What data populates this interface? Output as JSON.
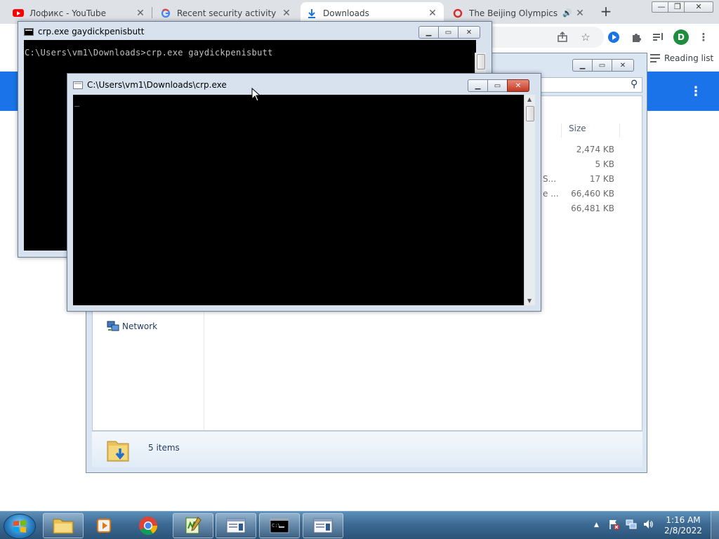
{
  "browser": {
    "tabs": [
      {
        "label": "Лофикс - YouTube",
        "favicon": "youtube-icon",
        "close": "✕"
      },
      {
        "label": "Recent security activity",
        "favicon": "google-icon",
        "close": "✕"
      },
      {
        "label": "Downloads",
        "favicon": "download-icon",
        "close": "✕"
      },
      {
        "label": "The Beijing Olympics S",
        "favicon": "red-circle-icon",
        "close": "✕",
        "audio": "🔊"
      }
    ],
    "new_tab": "+",
    "window_controls": {
      "minimize": "—",
      "maximize": "❐",
      "close": "✕"
    },
    "avatar_letter": "D",
    "reading_list": "Reading list",
    "menu": "⋮",
    "accent": "#1a73e8"
  },
  "explorer": {
    "search_glyph": "⚲",
    "columns": {
      "size": "Size"
    },
    "name_fragments": [
      "S...",
      "e ..."
    ],
    "sizes": [
      "2,474 KB",
      "5 KB",
      "17 KB",
      "66,460 KB",
      "66,481 KB"
    ],
    "nav": {
      "network": "Network"
    },
    "status": {
      "items": "5 items"
    },
    "window_controls": {
      "minimize": "▁",
      "maximize": "▭",
      "close": "✕"
    }
  },
  "console_back": {
    "title": "crp.exe  gaydickpenisbutt",
    "lines": [
      "C:\\Users\\vm1\\Downloads>crp.exe gaydickpenisbutt"
    ],
    "buttons": {
      "minimize": "▁",
      "maximize": "▭",
      "close": "✕"
    }
  },
  "console_front": {
    "title": "C:\\Users\\vm1\\Downloads\\crp.exe",
    "cursor": "_",
    "buttons": {
      "minimize": "▁",
      "maximize": "▭",
      "close": "✕"
    }
  },
  "taskbar": {
    "clock": {
      "time": "1:16 AM",
      "date": "2/8/2022"
    },
    "tray_expand": "▲"
  }
}
